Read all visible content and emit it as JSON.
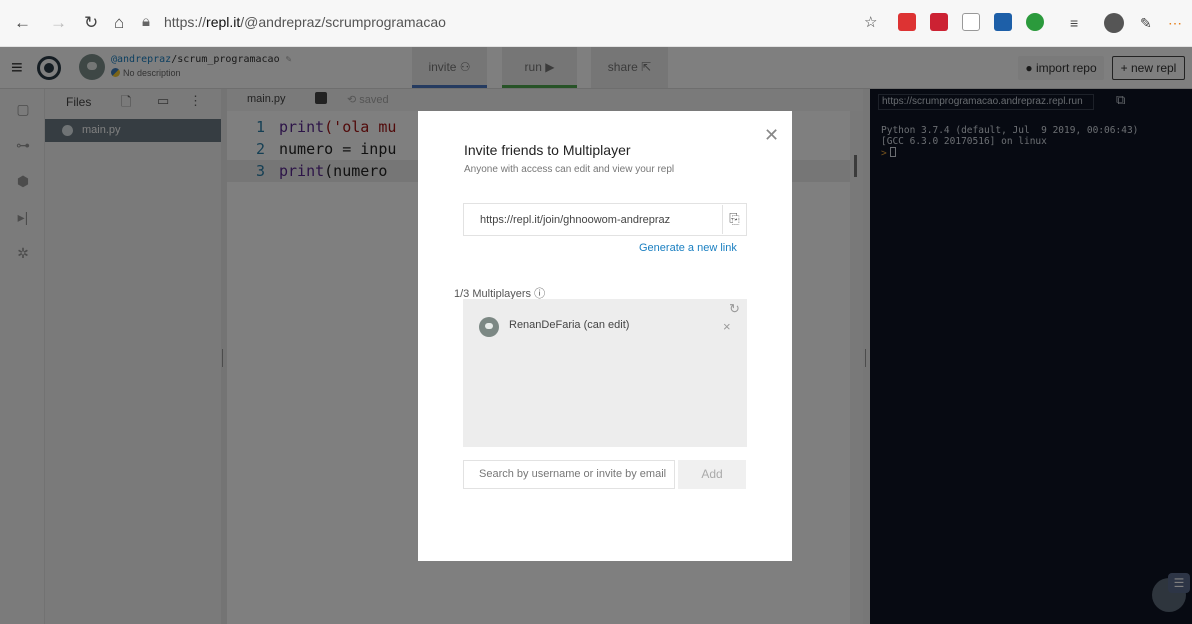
{
  "browser": {
    "url_prefix": "https://",
    "url_host": "repl.it",
    "url_path": "/@andrepraz/scrumprogramacao"
  },
  "header": {
    "user": "@andrepraz",
    "repl_name": "/scrum_programacao",
    "description": "No description",
    "tabs": [
      {
        "label": "invite"
      },
      {
        "label": "run"
      },
      {
        "label": "share"
      }
    ],
    "import_label": "import repo",
    "new_repl_label": "+ new repl"
  },
  "files": {
    "title": "Files",
    "items": [
      {
        "name": "main.py"
      }
    ]
  },
  "editor": {
    "tab_name": "main.py",
    "status": "saved",
    "lines": [
      {
        "num": "1",
        "fn": "print",
        "rest": "('ola mu"
      },
      {
        "num": "2",
        "fn": "",
        "rest": "numero = inpu"
      },
      {
        "num": "3",
        "fn": "print",
        "rest": "(numero"
      }
    ]
  },
  "console": {
    "url": "https://scrumprogramacao.andrepraz.repl.run",
    "line1": "Python 3.7.4 (default, Jul  9 2019, 00:06:43)",
    "line2": "[GCC 6.3.0 20170516] on linux",
    "prompt": ">"
  },
  "modal": {
    "title": "Invite friends to Multiplayer",
    "subtitle": "Anyone with access can edit and view your repl",
    "invite_link": "https://repl.it/join/ghnoowom-andrepraz",
    "generate_label": "Generate a new link",
    "multiplayers_label": "1/3 Multiplayers",
    "members": [
      {
        "name": "RenanDeFaria (can edit)"
      }
    ],
    "search_placeholder": "Search by username or invite by email",
    "add_label": "Add"
  }
}
